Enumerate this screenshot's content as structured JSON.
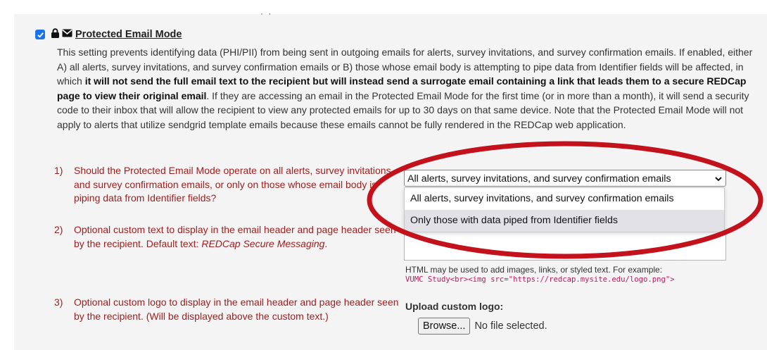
{
  "setting": {
    "title": "Protected Email Mode",
    "enabled": true,
    "description_parts": [
      {
        "text": "This setting prevents identifying data (PHI/PII) from being sent in outgoing emails for alerts, survey invitations, and survey confirmation emails. If enabled, either A) all alerts, survey invitations, and survey confirmation emails or B) those whose email body is attempting to pipe data from Identifier fields will be affected, in which ",
        "bold": false
      },
      {
        "text": "it will not send the full email text to the recipient but will instead send a surrogate email containing a link that leads them to a secure REDCap page to view their original email",
        "bold": true
      },
      {
        "text": ". If they are accessing an email in the Protected Email Mode for the first time (or in more than a month), it will send a security code to their inbox that will allow the recipient to view any protected emails for up to 30 days on that same device. Note that the Protected Email Mode will not apply to alerts that utilize sendgrid template emails because these emails cannot be fully rendered in the REDCap web application.",
        "bold": false
      }
    ]
  },
  "questions": [
    {
      "num": "1)",
      "text": "Should the Protected Email Mode operate on all alerts, survey invitations, and survey confirmation emails, or only on those whose email body is piping data from Identifier fields?"
    },
    {
      "num": "2)",
      "text_plain": "Optional custom text to display in the email header and page header seen by the recipient. Default text: ",
      "text_italic": "REDCap Secure Messaging",
      "text_end": "."
    },
    {
      "num": "3)",
      "text": "Optional custom logo to display in the email header and page header seen by the recipient. (Will be displayed above the custom text.)"
    }
  ],
  "mode_select": {
    "selected": "All alerts, survey invitations, and survey confirmation emails",
    "options": [
      "All alerts, survey invitations, and survey confirmation emails",
      "Only those with data piped from Identifier fields"
    ],
    "highlighted_index": 1
  },
  "custom_text": {
    "help": "HTML may be used to add images, links, or styled text. For example:",
    "example_code": "VUMC Study<br><img src=\"https://redcap.mysite.edu/logo.png\">"
  },
  "logo_upload": {
    "label": "Upload custom logo:",
    "browse_label": "Browse...",
    "file_status": "No file selected."
  },
  "colors": {
    "question_text": "#a01e1e",
    "annotation": "#c4121c",
    "checkbox": "#1a73e8",
    "code": "#c2185b"
  },
  "icons": [
    "checkbox-checked-icon",
    "lock-icon",
    "envelope-icon",
    "chevron-down-icon"
  ]
}
